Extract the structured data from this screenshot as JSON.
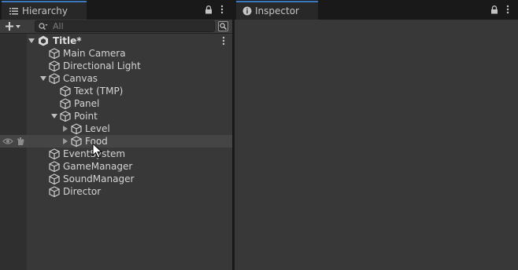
{
  "hierarchy_tab": {
    "label": "Hierarchy"
  },
  "inspector_tab": {
    "label": "Inspector"
  },
  "search": {
    "placeholder": "All"
  },
  "scene": {
    "name": "Title*"
  },
  "items": [
    {
      "label": "Main Camera"
    },
    {
      "label": "Directional Light"
    },
    {
      "label": "Canvas"
    },
    {
      "label": "Text (TMP)"
    },
    {
      "label": "Panel"
    },
    {
      "label": "Point"
    },
    {
      "label": "Level"
    },
    {
      "label": "Food"
    },
    {
      "label": "EventSystem"
    },
    {
      "label": "GameManager"
    },
    {
      "label": "SoundManager"
    },
    {
      "label": "Director"
    }
  ],
  "colors": {
    "accent": "#3a79bb",
    "panel": "#383838",
    "highlight": "#454545"
  }
}
